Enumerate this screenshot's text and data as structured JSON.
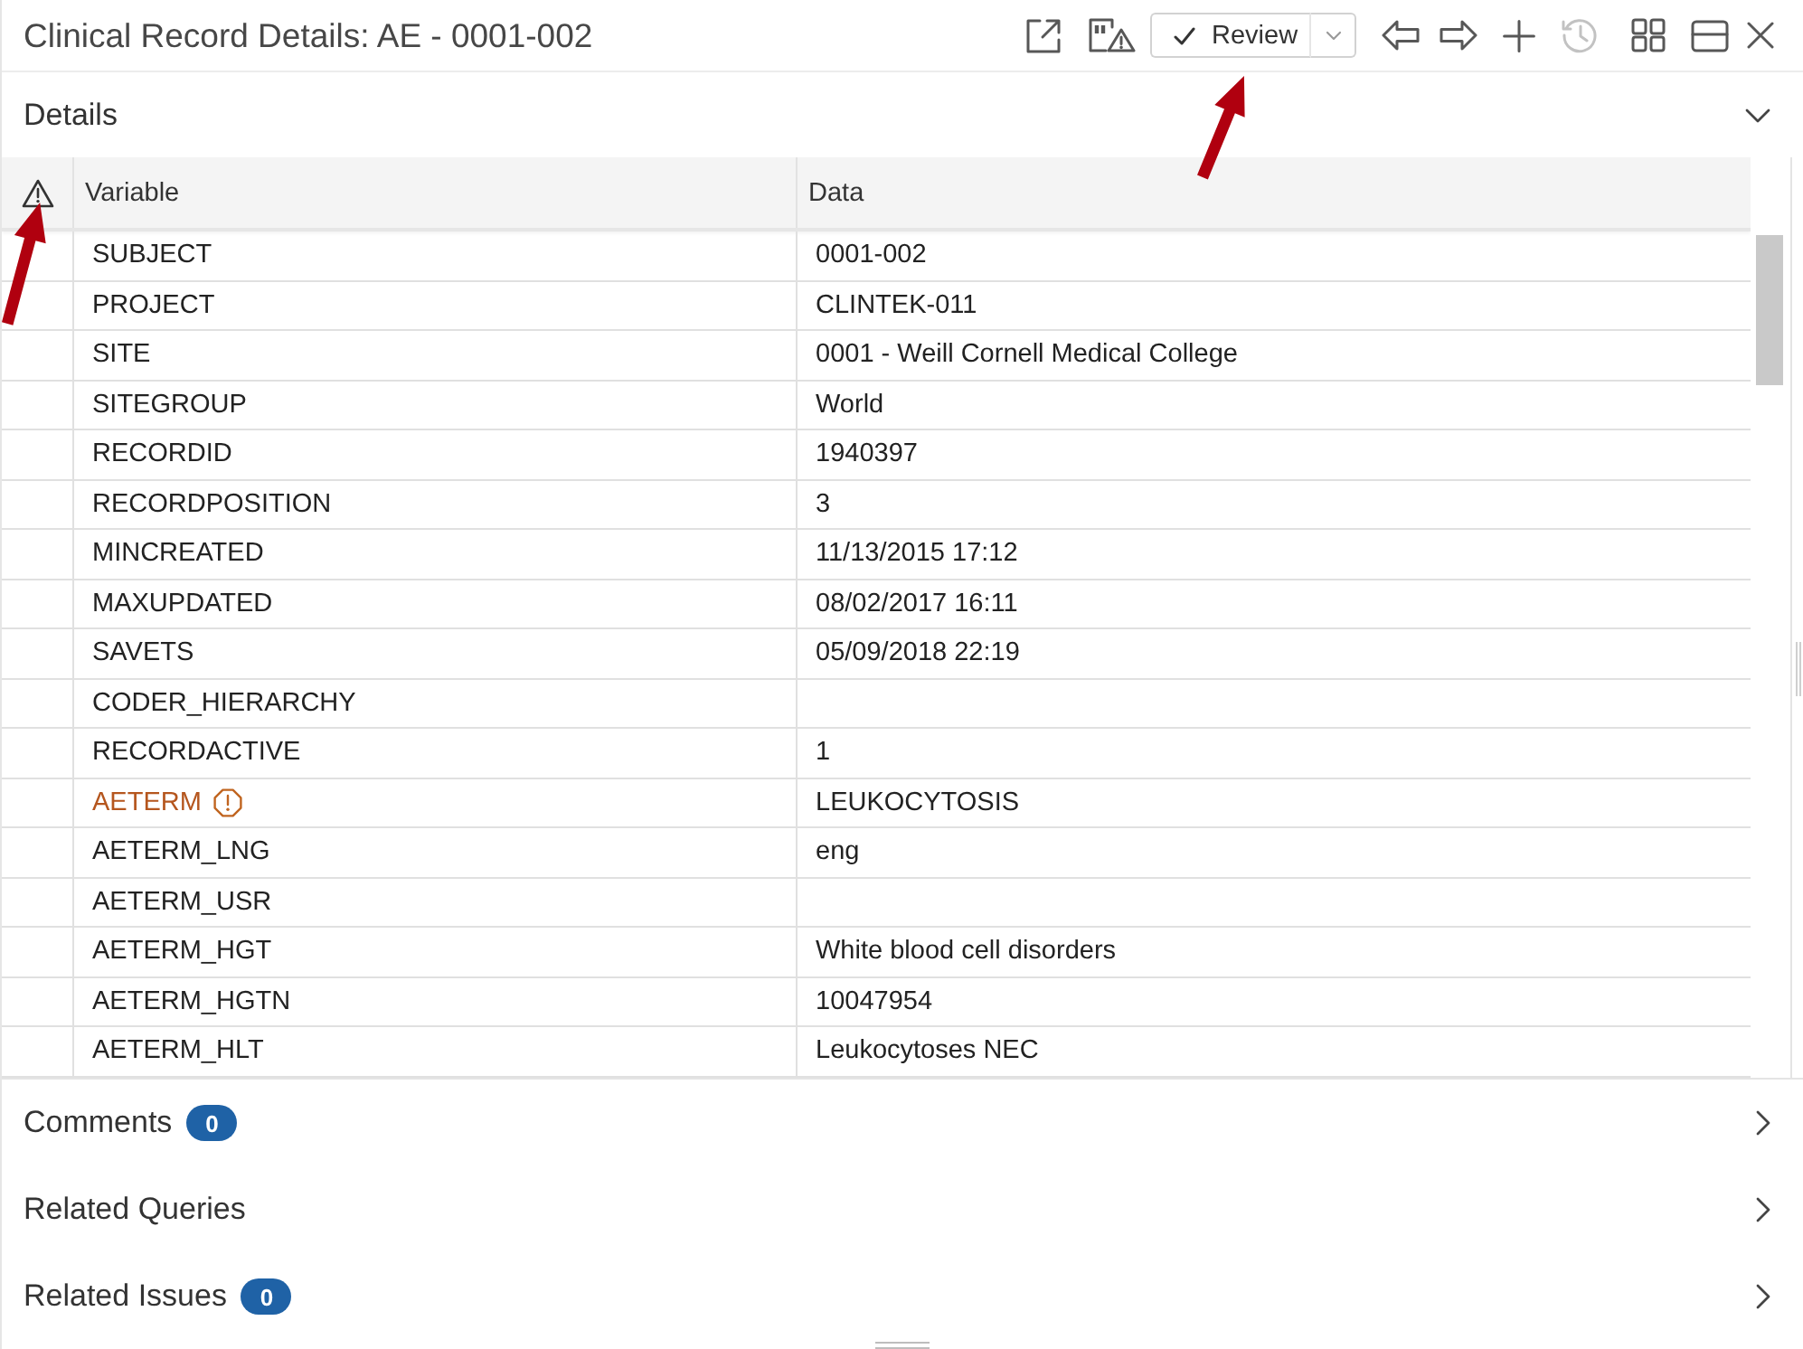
{
  "window": {
    "title": "Clinical Record Details: AE - 0001-002"
  },
  "toolbar": {
    "review": {
      "label": "Review"
    },
    "history": {
      "disabled": true
    }
  },
  "details": {
    "title": "Details",
    "expanded": true,
    "table": {
      "columns": [
        "Variable",
        "Data"
      ],
      "rows": [
        {
          "variable": "SUBJECT",
          "data": "0001-002",
          "flagged": false
        },
        {
          "variable": "PROJECT",
          "data": "CLINTEK-011",
          "flagged": false
        },
        {
          "variable": "SITE",
          "data": "0001 - Weill Cornell Medical College",
          "flagged": false
        },
        {
          "variable": "SITEGROUP",
          "data": "World",
          "flagged": false
        },
        {
          "variable": "RECORDID",
          "data": "1940397",
          "flagged": false
        },
        {
          "variable": "RECORDPOSITION",
          "data": "3",
          "flagged": false
        },
        {
          "variable": "MINCREATED",
          "data": "11/13/2015 17:12",
          "flagged": false
        },
        {
          "variable": "MAXUPDATED",
          "data": "08/02/2017 16:11",
          "flagged": false
        },
        {
          "variable": "SAVETS",
          "data": "05/09/2018 22:19",
          "flagged": false
        },
        {
          "variable": "CODER_HIERARCHY",
          "flagged": false
        },
        {
          "variable": "RECORDACTIVE",
          "data": "1",
          "flagged": false
        },
        {
          "variable": "AETERM",
          "data": "LEUKOCYTOSIS",
          "flagged": true
        },
        {
          "variable": "AETERM_LNG",
          "data": "eng",
          "flagged": false
        },
        {
          "variable": "AETERM_USR",
          "flagged": false
        },
        {
          "variable": "AETERM_HGT",
          "data": "White blood cell disorders",
          "flagged": false
        },
        {
          "variable": "AETERM_HGTN",
          "data": "10047954",
          "flagged": false
        },
        {
          "variable": "AETERM_HLT",
          "data": "Leukocytoses NEC",
          "flagged": false
        }
      ]
    }
  },
  "sections": [
    {
      "title": "Comments",
      "count": "0",
      "expanded": false
    },
    {
      "title": "Related Queries",
      "expanded": false
    },
    {
      "title": "Related Issues",
      "count": "0",
      "expanded": false
    }
  ]
}
